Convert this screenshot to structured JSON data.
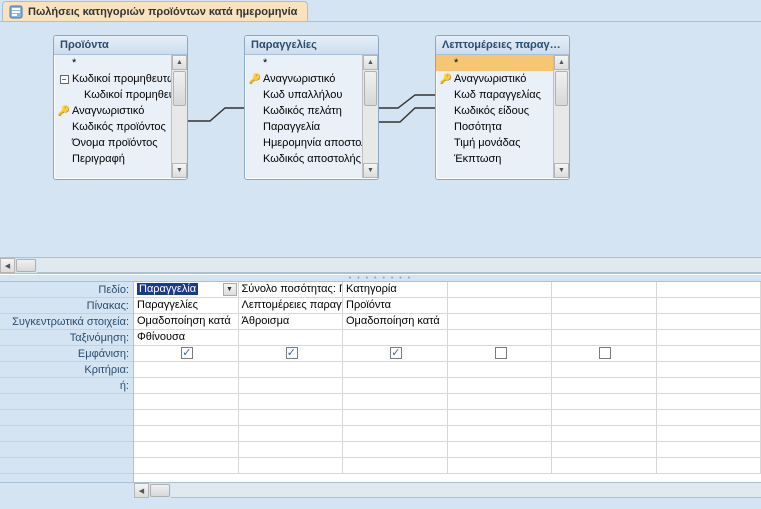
{
  "tab": {
    "title": "Πωλήσεις κατηγοριών προϊόντων κατά ημερομηνία"
  },
  "tables": {
    "products": {
      "title": "Προϊόντα",
      "star": "*",
      "fields": [
        {
          "text": "Κωδικοί προμηθευτών",
          "expander": true
        },
        {
          "text": "Κωδικοί προμηθευτών"
        },
        {
          "text": "Αναγνωριστικό",
          "key": true
        },
        {
          "text": "Κωδικός προϊόντος"
        },
        {
          "text": "Όνομα προϊόντος"
        },
        {
          "text": "Περιγραφή"
        }
      ]
    },
    "orders": {
      "title": "Παραγγελίες",
      "star": "*",
      "fields": [
        {
          "text": "Αναγνωριστικό",
          "key": true
        },
        {
          "text": "Κωδ υπαλλήλου"
        },
        {
          "text": "Κωδικός πελάτη"
        },
        {
          "text": "Παραγγελία"
        },
        {
          "text": "Ημερομηνία αποστολής"
        },
        {
          "text": "Κωδικός αποστολής"
        }
      ]
    },
    "details": {
      "title": "Λεπτομέρειες παραγγελιών",
      "star": "*",
      "fields": [
        {
          "text": "Αναγνωριστικό",
          "key": true
        },
        {
          "text": "Κωδ παραγγελίας"
        },
        {
          "text": "Κωδικός είδους"
        },
        {
          "text": "Ποσότητα"
        },
        {
          "text": "Τιμή μονάδας"
        },
        {
          "text": "Έκπτωση"
        }
      ]
    }
  },
  "rowLabels": {
    "field": "Πεδίο:",
    "table": "Πίνακας:",
    "total": "Συγκεντρωτικά στοιχεία:",
    "sort": "Ταξινόμηση:",
    "show": "Εμφάνιση:",
    "criteria": "Κριτήρια:",
    "or": "ή:"
  },
  "cols": [
    {
      "field": "Παραγγελία",
      "table": "Παραγγελίες",
      "total": "Ομαδοποίηση κατά",
      "sort": "Φθίνουσα",
      "show": true,
      "active": true
    },
    {
      "field": "Σύνολο ποσότητας: Ποσότητα",
      "table": "Λεπτομέρειες παραγγελιών",
      "total": "Άθροισμα",
      "sort": "",
      "show": true
    },
    {
      "field": "Κατηγορία",
      "table": "Προϊόντα",
      "total": "Ομαδοποίηση κατά",
      "sort": "",
      "show": true
    },
    {
      "field": "",
      "table": "",
      "total": "",
      "sort": "",
      "show": false
    },
    {
      "field": "",
      "table": "",
      "total": "",
      "sort": "",
      "show": false
    }
  ]
}
